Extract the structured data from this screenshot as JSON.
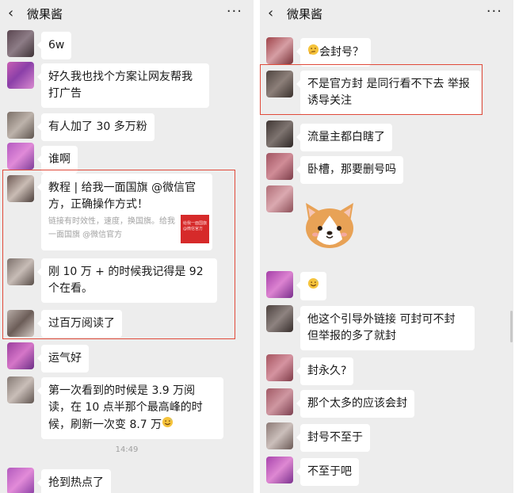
{
  "left": {
    "header": {
      "back": "‹",
      "title": "微果酱",
      "more": "···"
    },
    "messages": [
      {
        "text": "6w"
      },
      {
        "text": "好久我也找个方案让网友帮我打广告"
      },
      {
        "text": "有人加了 30 多万粉"
      },
      {
        "text": "谁啊"
      },
      {
        "card_title": "教程 | 给我一面国旗 @微信官方，正确操作方式！",
        "card_desc": "链接有时效性，速度，换国旗。给我一面国旗 @微信官方",
        "card_thumb": "给我一面国旗@微信官方"
      },
      {
        "text": "刚 10 万 + 的时候我记得是 92 个在看。"
      },
      {
        "text": "过百万阅读了"
      },
      {
        "text": "运气好"
      },
      {
        "text": "第一次看到的时候是 3.9 万阅读，在 10 点半那个最高峰的时候，刷新一次变 8.7 万"
      },
      {
        "text": "抢到热点了"
      }
    ],
    "timestamp": "14:49"
  },
  "right": {
    "header": {
      "back": "‹",
      "title": "微果酱",
      "more": "···"
    },
    "messages": [
      {
        "text": "会封号？"
      },
      {
        "text": "不是官方封  是同行看不下去  举报诱导关注"
      },
      {
        "text": "流量主都白瞎了"
      },
      {
        "text": "卧槽，那要删号吗"
      },
      {
        "sticker": "corgi-sticker"
      },
      {
        "text": ""
      },
      {
        "text": "他这个引导外链接  可封可不封  但举报的多了就封"
      },
      {
        "text": "封永久?"
      },
      {
        "text": "那个太多的应该会封"
      },
      {
        "text": "封号不至于"
      },
      {
        "text": "不至于吧"
      }
    ]
  },
  "colors": {
    "bubble": "#ffffff",
    "background": "#ededed",
    "highlight_box": "#e04a3a",
    "card_thumb": "#d62a2a"
  }
}
